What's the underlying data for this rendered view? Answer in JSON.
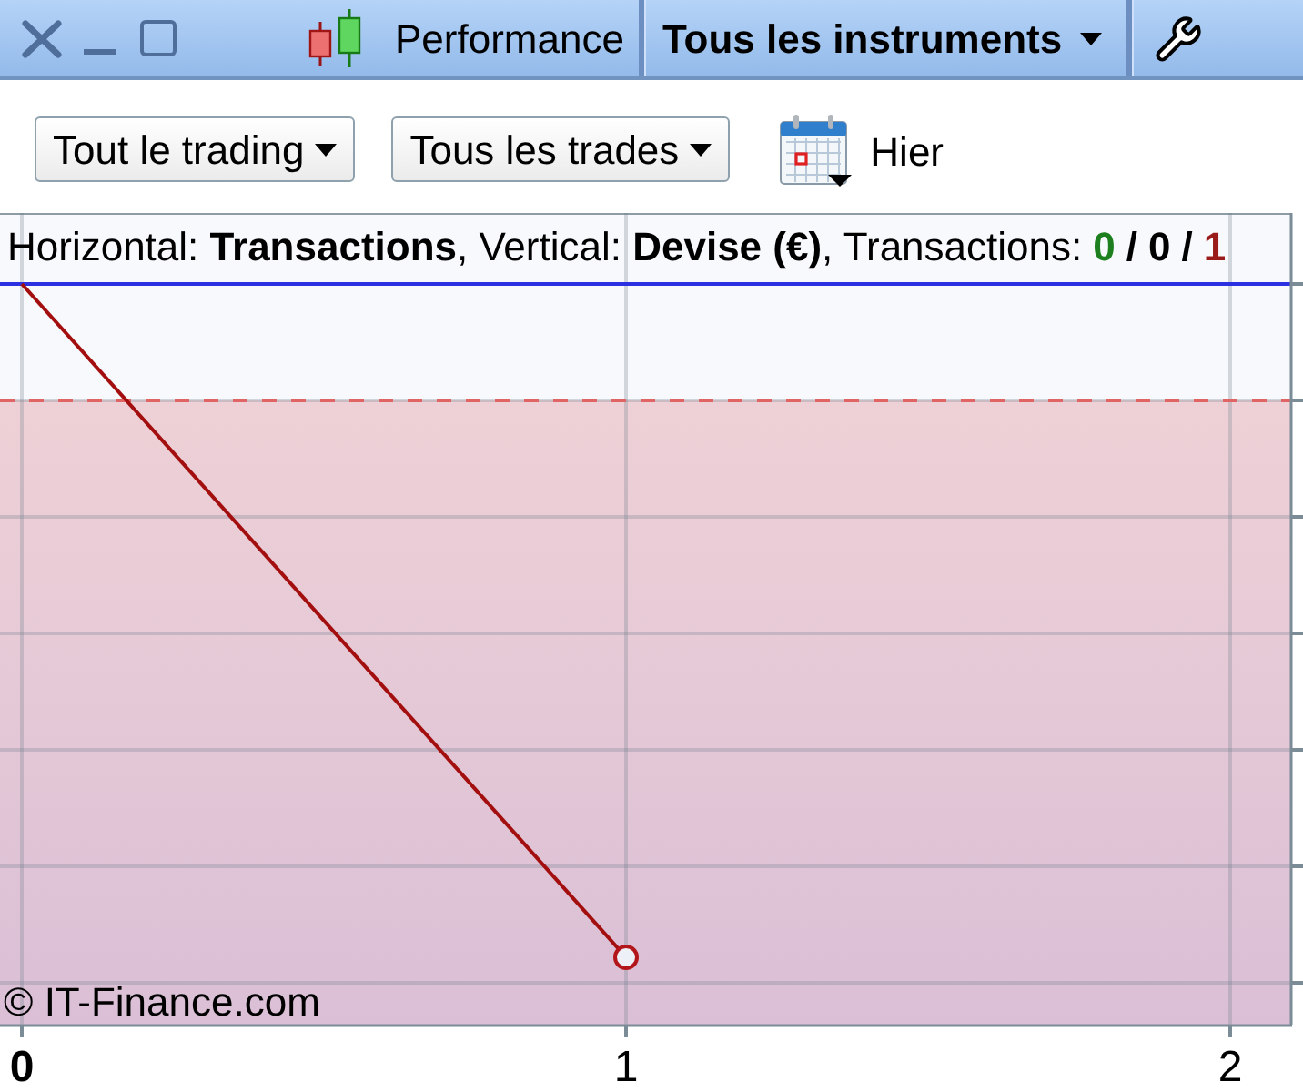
{
  "header_bar": {
    "title": "Performance",
    "instrument_filter": "Tous les instruments"
  },
  "toolbar": {
    "dropdowns": [
      "Tout le trading",
      "Tous les trades"
    ],
    "date": "Hier"
  },
  "chart": {
    "summary": "Horizontal: **Transactions**, Vertical: **Devise (€)**, Transactions:",
    "counts": [
      {
        "value": "0",
        "color": "#1d7f1d"
      },
      {
        "value": "0",
        "color": "#000000"
      },
      {
        "value": "1",
        "color": "#9b1b1b"
      }
    ],
    "separators": [
      "/",
      "/"
    ],
    "copyright": "© IT-Finance.com",
    "x_labels": [
      {
        "label": "0",
        "bold": true
      },
      {
        "label": "1",
        "bold": false
      },
      {
        "label": "2",
        "bold": false
      }
    ]
  }
}
